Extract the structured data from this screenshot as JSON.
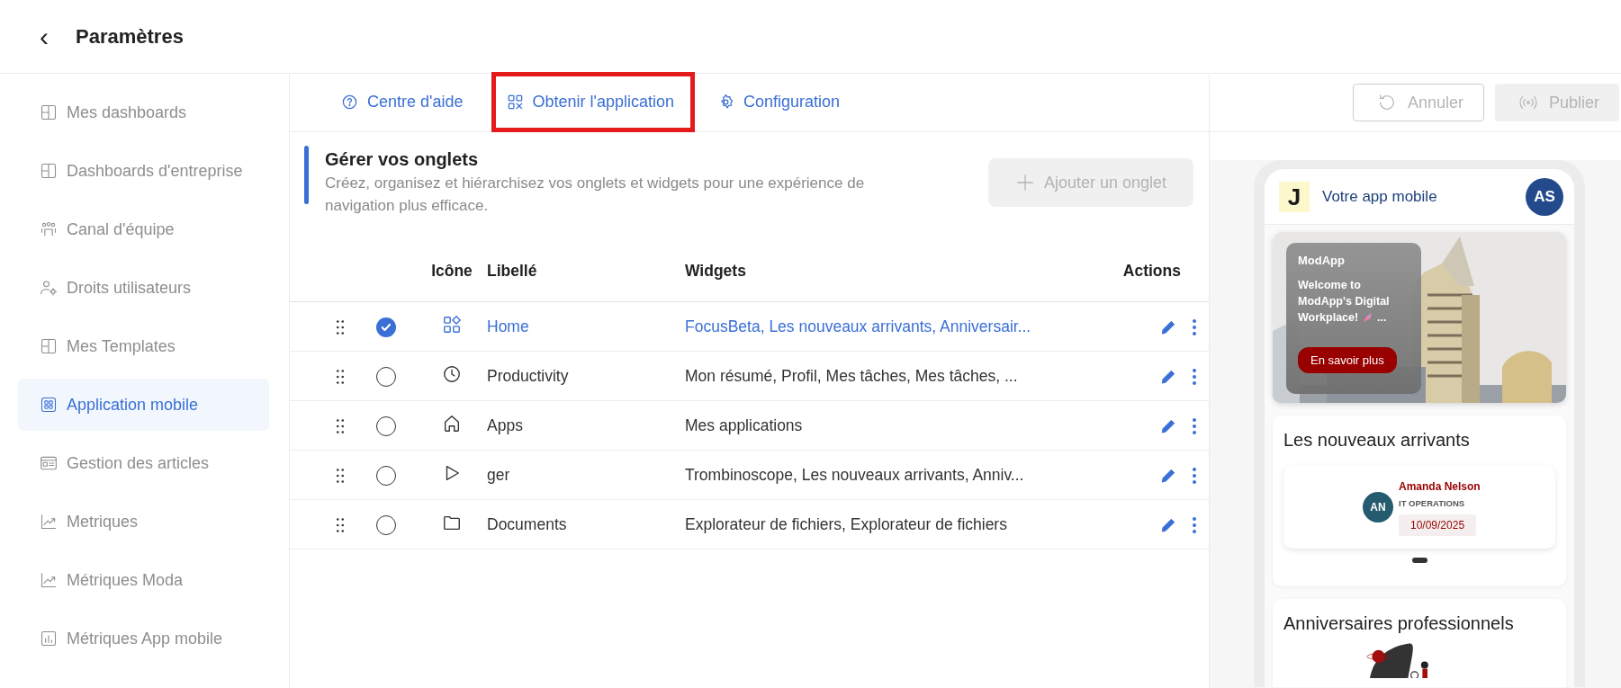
{
  "header": {
    "back": "‹",
    "title": "Paramètres"
  },
  "sidebar": {
    "items": [
      {
        "label": "Mes dashboards",
        "selected": false
      },
      {
        "label": "Dashboards d'entreprise",
        "selected": false
      },
      {
        "label": "Canal d'équipe",
        "selected": false
      },
      {
        "label": "Droits utilisateurs",
        "selected": false
      },
      {
        "label": "Mes Templates",
        "selected": false
      },
      {
        "label": "Application mobile",
        "selected": true
      },
      {
        "label": "Gestion des articles",
        "selected": false
      },
      {
        "label": "Metriques",
        "selected": false
      },
      {
        "label": "Métriques Moda",
        "selected": false
      },
      {
        "label": "Métriques App mobile",
        "selected": false
      }
    ]
  },
  "tabs": [
    {
      "label": "Centre d'aide",
      "highlighted": false
    },
    {
      "label": "Obtenir l'application",
      "highlighted": true
    },
    {
      "label": "Configuration",
      "highlighted": false
    }
  ],
  "section": {
    "title": "Gérer vos onglets",
    "description": "Créez, organisez et hiérarchisez vos onglets et widgets pour une expérience de navigation plus efficace.",
    "add_button": {
      "label": "Ajouter un onglet",
      "disabled": true
    }
  },
  "table": {
    "columns": [
      "Icône",
      "Libellé",
      "Widgets",
      "Actions"
    ],
    "rows": [
      {
        "selected": true,
        "label": "Home",
        "widgets": "FocusBeta, Les nouveaux arrivants, Anniversair..."
      },
      {
        "selected": false,
        "label": "Productivity",
        "widgets": "Mon résumé, Profil, Mes tâches, Mes tâches, ..."
      },
      {
        "selected": false,
        "label": "Apps",
        "widgets": "Mes applications"
      },
      {
        "selected": false,
        "label": "ger",
        "widgets": "Trombinoscope, Les nouveaux arrivants, Anniv..."
      },
      {
        "selected": false,
        "label": "Documents",
        "widgets": "Explorateur de fichiers, Explorateur de fichiers"
      }
    ]
  },
  "actions": [
    {
      "label": "Annuler",
      "disabled": true,
      "kind": "outline"
    },
    {
      "label": "Publier",
      "disabled": true,
      "kind": "solid"
    }
  ],
  "preview": {
    "logo": "J",
    "app_title": "Votre app mobile",
    "avatar": "AS",
    "banner": {
      "kind": "picture",
      "brand": "ModApp",
      "message": "Welcome to ModApp's Digital Workplace!",
      "more": "...",
      "button": "En savoir plus"
    },
    "newcomers": {
      "title": "Les nouveaux arrivants",
      "person": {
        "initials": "AN",
        "name": "Amanda Nelson",
        "department": "IT OPERATIONS",
        "date": "10/09/2025"
      }
    },
    "anniversaries": {
      "title": "Anniversaires professionnels"
    }
  }
}
